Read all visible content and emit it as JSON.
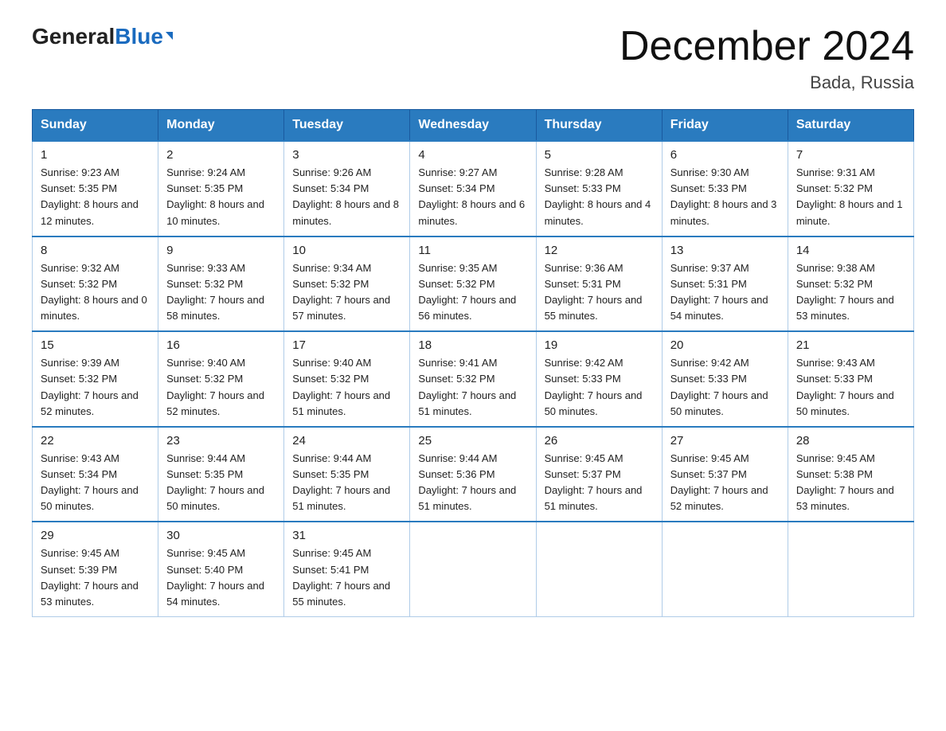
{
  "logo": {
    "general": "General",
    "blue": "Blue",
    "arrow": "▼"
  },
  "header": {
    "title": "December 2024",
    "location": "Bada, Russia"
  },
  "weekdays": [
    "Sunday",
    "Monday",
    "Tuesday",
    "Wednesday",
    "Thursday",
    "Friday",
    "Saturday"
  ],
  "weeks": [
    [
      {
        "day": "1",
        "sunrise": "9:23 AM",
        "sunset": "5:35 PM",
        "daylight": "8 hours and 12 minutes."
      },
      {
        "day": "2",
        "sunrise": "9:24 AM",
        "sunset": "5:35 PM",
        "daylight": "8 hours and 10 minutes."
      },
      {
        "day": "3",
        "sunrise": "9:26 AM",
        "sunset": "5:34 PM",
        "daylight": "8 hours and 8 minutes."
      },
      {
        "day": "4",
        "sunrise": "9:27 AM",
        "sunset": "5:34 PM",
        "daylight": "8 hours and 6 minutes."
      },
      {
        "day": "5",
        "sunrise": "9:28 AM",
        "sunset": "5:33 PM",
        "daylight": "8 hours and 4 minutes."
      },
      {
        "day": "6",
        "sunrise": "9:30 AM",
        "sunset": "5:33 PM",
        "daylight": "8 hours and 3 minutes."
      },
      {
        "day": "7",
        "sunrise": "9:31 AM",
        "sunset": "5:32 PM",
        "daylight": "8 hours and 1 minute."
      }
    ],
    [
      {
        "day": "8",
        "sunrise": "9:32 AM",
        "sunset": "5:32 PM",
        "daylight": "8 hours and 0 minutes."
      },
      {
        "day": "9",
        "sunrise": "9:33 AM",
        "sunset": "5:32 PM",
        "daylight": "7 hours and 58 minutes."
      },
      {
        "day": "10",
        "sunrise": "9:34 AM",
        "sunset": "5:32 PM",
        "daylight": "7 hours and 57 minutes."
      },
      {
        "day": "11",
        "sunrise": "9:35 AM",
        "sunset": "5:32 PM",
        "daylight": "7 hours and 56 minutes."
      },
      {
        "day": "12",
        "sunrise": "9:36 AM",
        "sunset": "5:31 PM",
        "daylight": "7 hours and 55 minutes."
      },
      {
        "day": "13",
        "sunrise": "9:37 AM",
        "sunset": "5:31 PM",
        "daylight": "7 hours and 54 minutes."
      },
      {
        "day": "14",
        "sunrise": "9:38 AM",
        "sunset": "5:32 PM",
        "daylight": "7 hours and 53 minutes."
      }
    ],
    [
      {
        "day": "15",
        "sunrise": "9:39 AM",
        "sunset": "5:32 PM",
        "daylight": "7 hours and 52 minutes."
      },
      {
        "day": "16",
        "sunrise": "9:40 AM",
        "sunset": "5:32 PM",
        "daylight": "7 hours and 52 minutes."
      },
      {
        "day": "17",
        "sunrise": "9:40 AM",
        "sunset": "5:32 PM",
        "daylight": "7 hours and 51 minutes."
      },
      {
        "day": "18",
        "sunrise": "9:41 AM",
        "sunset": "5:32 PM",
        "daylight": "7 hours and 51 minutes."
      },
      {
        "day": "19",
        "sunrise": "9:42 AM",
        "sunset": "5:33 PM",
        "daylight": "7 hours and 50 minutes."
      },
      {
        "day": "20",
        "sunrise": "9:42 AM",
        "sunset": "5:33 PM",
        "daylight": "7 hours and 50 minutes."
      },
      {
        "day": "21",
        "sunrise": "9:43 AM",
        "sunset": "5:33 PM",
        "daylight": "7 hours and 50 minutes."
      }
    ],
    [
      {
        "day": "22",
        "sunrise": "9:43 AM",
        "sunset": "5:34 PM",
        "daylight": "7 hours and 50 minutes."
      },
      {
        "day": "23",
        "sunrise": "9:44 AM",
        "sunset": "5:35 PM",
        "daylight": "7 hours and 50 minutes."
      },
      {
        "day": "24",
        "sunrise": "9:44 AM",
        "sunset": "5:35 PM",
        "daylight": "7 hours and 51 minutes."
      },
      {
        "day": "25",
        "sunrise": "9:44 AM",
        "sunset": "5:36 PM",
        "daylight": "7 hours and 51 minutes."
      },
      {
        "day": "26",
        "sunrise": "9:45 AM",
        "sunset": "5:37 PM",
        "daylight": "7 hours and 51 minutes."
      },
      {
        "day": "27",
        "sunrise": "9:45 AM",
        "sunset": "5:37 PM",
        "daylight": "7 hours and 52 minutes."
      },
      {
        "day": "28",
        "sunrise": "9:45 AM",
        "sunset": "5:38 PM",
        "daylight": "7 hours and 53 minutes."
      }
    ],
    [
      {
        "day": "29",
        "sunrise": "9:45 AM",
        "sunset": "5:39 PM",
        "daylight": "7 hours and 53 minutes."
      },
      {
        "day": "30",
        "sunrise": "9:45 AM",
        "sunset": "5:40 PM",
        "daylight": "7 hours and 54 minutes."
      },
      {
        "day": "31",
        "sunrise": "9:45 AM",
        "sunset": "5:41 PM",
        "daylight": "7 hours and 55 minutes."
      },
      null,
      null,
      null,
      null
    ]
  ],
  "labels": {
    "sunrise": "Sunrise:",
    "sunset": "Sunset:",
    "daylight": "Daylight:"
  }
}
